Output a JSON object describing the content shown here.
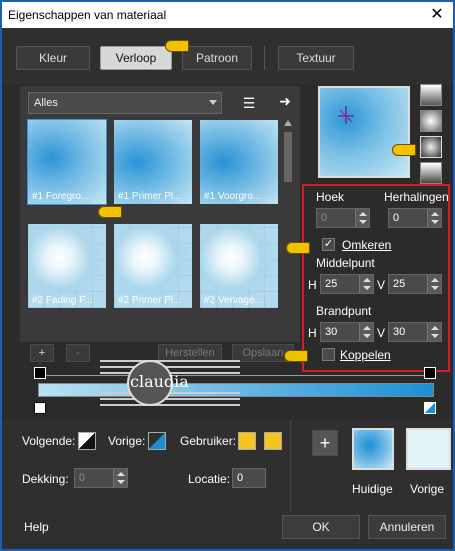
{
  "window": {
    "title": "Eigenschappen van materiaal",
    "close_glyph": "✕"
  },
  "tabs": [
    {
      "label": "Kleur",
      "active": false
    },
    {
      "label": "Verloop",
      "active": true
    },
    {
      "label": "Patroon",
      "active": false
    },
    {
      "label": "Textuur",
      "active": false
    }
  ],
  "library": {
    "category_selected": "Alles",
    "items": [
      {
        "label": "#1 Foregro...",
        "selected": true
      },
      {
        "label": "#1 Primer Pl...",
        "selected": false
      },
      {
        "label": "#1 Voorgro...",
        "selected": false
      },
      {
        "label": "#2 Fading F...",
        "selected": false
      },
      {
        "label": "#2 Primer Pl...",
        "selected": false
      },
      {
        "label": "#2 Vervage...",
        "selected": false
      }
    ],
    "add_label": "+",
    "remove_label": "-",
    "restore_label": "Herstellen",
    "save_label": "Opslaan"
  },
  "settings": {
    "angle_label": "Hoek",
    "angle_value": "0",
    "repeats_label": "Herhalingen",
    "repeats_value": "0",
    "invert_label": "Omkeren",
    "invert_checked": true,
    "center_label": "Middelpunt",
    "center_h_label": "H",
    "center_h_value": "25",
    "center_v_label": "V",
    "center_v_value": "25",
    "focal_label": "Brandpunt",
    "focal_h_label": "H",
    "focal_h_value": "30",
    "focal_v_label": "V",
    "focal_v_value": "30",
    "link_label": "Koppelen",
    "link_checked": false
  },
  "watermark": {
    "text": "claudia"
  },
  "colors": {
    "gradient_start": "#b9e1f3",
    "gradient_end": "#1c8fd3",
    "accent_yellow": "#f2c200",
    "user_swatch": "#f4c51f",
    "current_swatch": "#2f9ad9",
    "previous_swatch": "#e3f3f7"
  },
  "bottom": {
    "foreground_label": "Volgende:",
    "previous_label": "Vorige:",
    "user_label": "Gebruiker:",
    "opacity_label": "Dekking:",
    "opacity_value": "0",
    "location_label": "Locatie:",
    "location_value": "0",
    "add_label": "+",
    "current_label": "Huidige",
    "previous_caption": "Vorige"
  },
  "footer": {
    "help_label": "Help",
    "ok_label": "OK",
    "cancel_label": "Annuleren"
  }
}
